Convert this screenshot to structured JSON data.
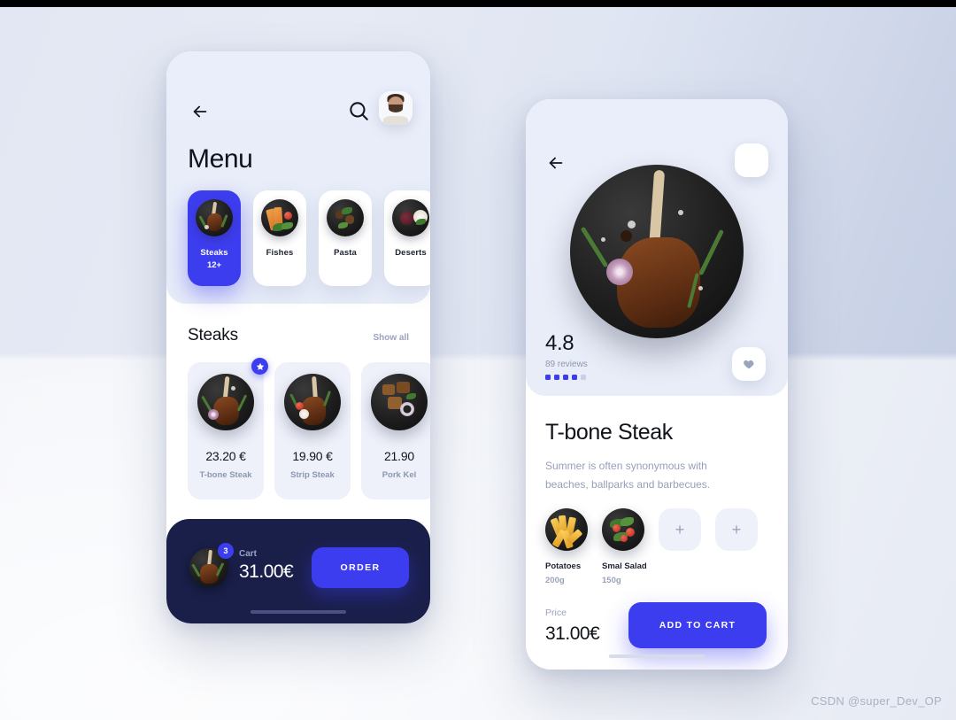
{
  "background": {
    "accent_color": "#3d3df0",
    "navy_color": "#1a1f4a",
    "light_panel": "#eaeefa",
    "card_bg": "#eef1fa"
  },
  "menu_screen": {
    "back_icon": "arrow-left-icon",
    "search_icon": "search-icon",
    "avatar_icon": "user-avatar",
    "title": "Menu",
    "categories": [
      {
        "name": "Steaks",
        "count": "12+",
        "active": true
      },
      {
        "name": "Fishes",
        "count": "",
        "active": false
      },
      {
        "name": "Pasta",
        "count": "",
        "active": false
      },
      {
        "name": "Deserts",
        "count": "",
        "active": false
      }
    ],
    "section": {
      "title": "Steaks",
      "show_all": "Show all"
    },
    "items": [
      {
        "price": "23.20 €",
        "name": "T-bone Steak",
        "featured": true
      },
      {
        "price": "19.90 €",
        "name": "Strip Steak",
        "featured": false
      },
      {
        "price": "21.90",
        "name": "Pork Kel",
        "featured": false
      }
    ],
    "cart": {
      "badge": "3",
      "label": "Cart",
      "total": "31.00€",
      "order_button": "ORDER"
    }
  },
  "detail_screen": {
    "back_icon": "arrow-left-icon",
    "avatar_icon": "user-avatar",
    "hero_icon": "tbone-steak-photo",
    "rating": "4.8",
    "reviews": "89 reviews",
    "rating_dots": [
      true,
      true,
      true,
      true,
      false
    ],
    "favorite_icon": "heart-icon",
    "title": "T-bone Steak",
    "description": "Summer is often synonymous with beaches, ballparks and barbecues.",
    "sides": [
      {
        "name": "Potatoes",
        "weight": "200g",
        "type": "image"
      },
      {
        "name": "Smal Salad",
        "weight": "150g",
        "type": "image"
      },
      {
        "name": "",
        "weight": "",
        "type": "add",
        "add_label": "+"
      },
      {
        "name": "",
        "weight": "",
        "type": "add",
        "add_label": "+"
      }
    ],
    "price_label": "Price",
    "price_value": "31.00€",
    "add_to_cart": "ADD TO CART"
  },
  "watermark": "CSDN @super_Dev_OP"
}
